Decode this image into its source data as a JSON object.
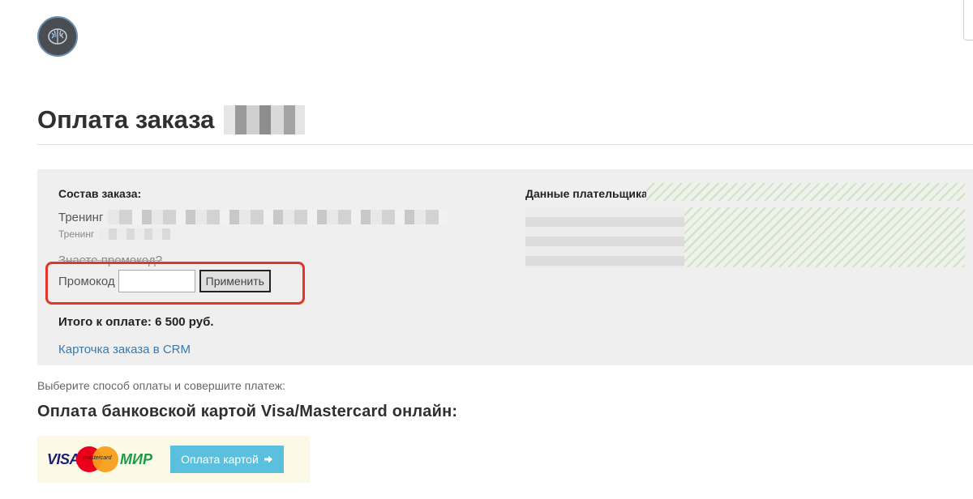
{
  "header": {
    "logo_icon": "brain-icon"
  },
  "page": {
    "title": "Оплата заказа"
  },
  "order": {
    "heading": "Состав заказа:",
    "items": [
      {
        "label": "Тренинг"
      },
      {
        "label": "Тренинг"
      }
    ],
    "promo": {
      "question": "Знаете промокод?",
      "label": "Промокод",
      "value": "",
      "apply_label": "Применить"
    },
    "total": "Итого к оплате: 6 500 руб.",
    "crm_link": "Карточка заказа в CRM"
  },
  "payer": {
    "heading": "Данные плательщика:"
  },
  "payment": {
    "choose_text": "Выберите способ оплаты и совершите платеж:",
    "bank_title": "Оплата банковской картой Visa/Mastercard онлайн:",
    "visa_label": "VISA",
    "mastercard_label": "mastercard",
    "mir_label": "МИР",
    "pay_button_label": "Оплата картой",
    "pay_button_icon": "arrow-right-icon"
  },
  "colors": {
    "highlight": "#e0362c",
    "link": "#3a79b0",
    "pay_button": "#5bc0de",
    "panel_bg": "#efefef"
  }
}
